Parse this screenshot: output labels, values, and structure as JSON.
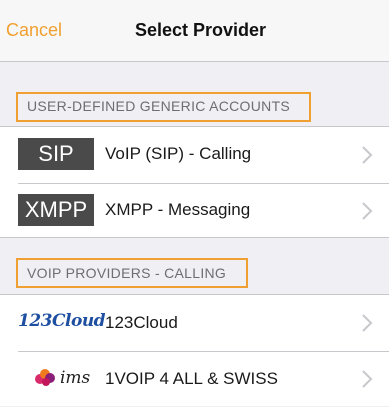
{
  "navbar": {
    "cancel_label": "Cancel",
    "title": "Select Provider"
  },
  "sections": {
    "generic": {
      "header": "USER-DEFINED GENERIC ACCOUNTS",
      "items": [
        {
          "badge": "SIP",
          "label": "VoIP (SIP) - Calling"
        },
        {
          "badge": "XMPP",
          "label": "XMPP - Messaging"
        }
      ]
    },
    "voip": {
      "header": "VOIP PROVIDERS - CALLING",
      "items": [
        {
          "logo_text": "123Cloud",
          "logo_icon": "123cloud-logo",
          "label": "123Cloud"
        },
        {
          "logo_text": "ims",
          "logo_icon": "ims-logo",
          "label": "1VOIP 4 ALL & SWISS"
        }
      ]
    }
  },
  "colors": {
    "accent": "#f0a030",
    "badge_bg": "#4a4a4a",
    "background": "#efeff4",
    "logo_blue": "#1f4fa0"
  }
}
